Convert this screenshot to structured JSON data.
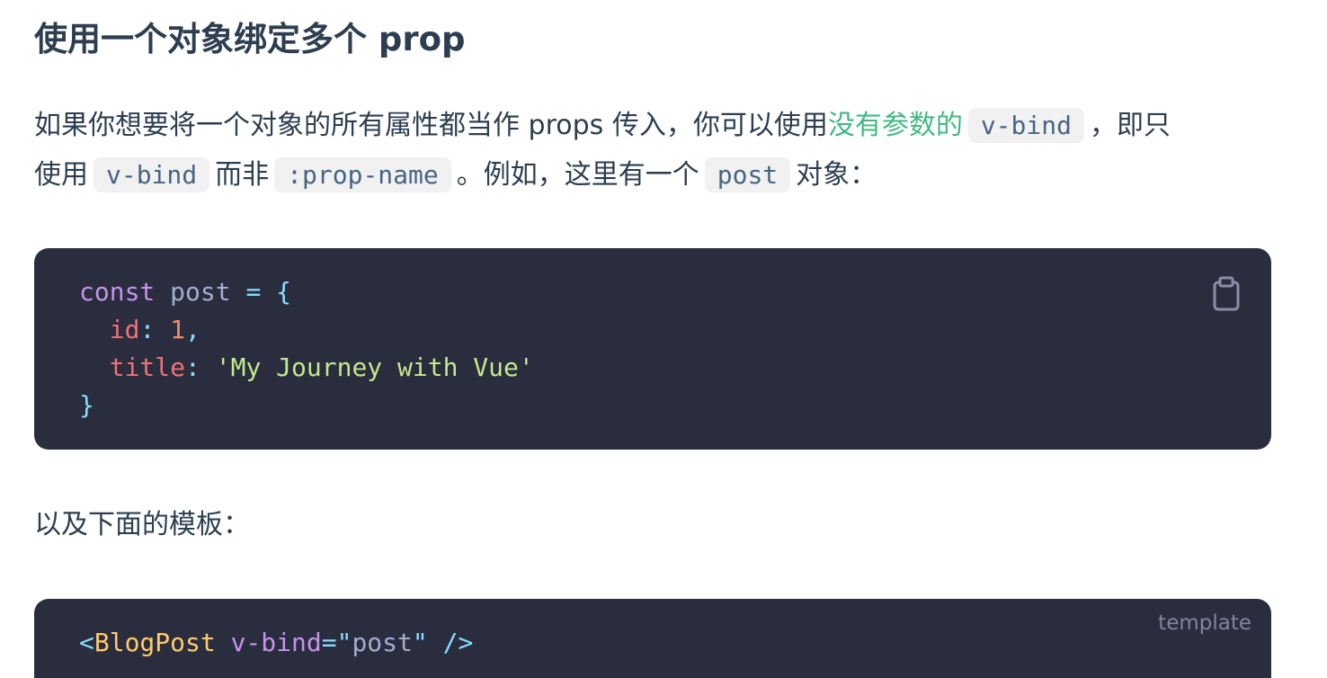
{
  "heading": "使用一个对象绑定多个 prop",
  "paragraph1": {
    "text_a": "如果你想要将一个对象的所有属性都当作 props 传入，你可以使用",
    "link": "没有参数的",
    "code_a": "v-bind",
    "text_b": "，即只",
    "text_c": "使用",
    "code_b": "v-bind",
    "text_d": "而非",
    "code_c": ":prop-name",
    "text_e": "。例如，这里有一个",
    "code_d": "post",
    "text_f": "对象："
  },
  "code_block_1": {
    "line1": {
      "kw": "const",
      "var": "post",
      "op": "= {"
    },
    "line2": {
      "prop": "id",
      "colon": ":",
      "num": "1",
      "comma": ","
    },
    "line3": {
      "prop": "title",
      "colon": ":",
      "str": "'My Journey with Vue'"
    },
    "line4": {
      "brace": "}"
    },
    "copy_icon": "clipboard-icon"
  },
  "paragraph2": "以及下面的模板：",
  "code_block_2": {
    "lang": "template",
    "open": "<",
    "tag": "BlogPost",
    "attr": "v-bind",
    "eq": "=\"",
    "value": "post",
    "close": "\" />"
  },
  "colors": {
    "bg": "#ffffff",
    "text": "#2c3e50",
    "link": "#42b883",
    "code_bg": "#292d3e",
    "inline_code_bg": "#f1f1f1"
  }
}
